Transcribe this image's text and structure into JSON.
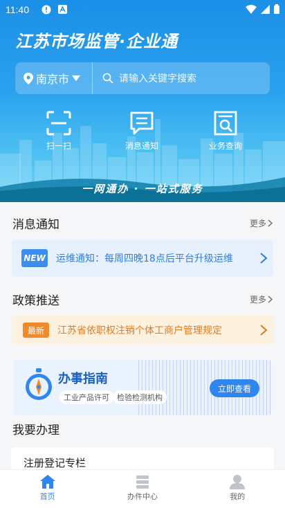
{
  "status_bar": {
    "time": "11:40"
  },
  "header": {
    "title": "江苏市场监管·企业通",
    "city": "南京市",
    "search_placeholder": "请输入关键字搜索"
  },
  "quick_actions": [
    {
      "label": "扫一扫",
      "icon": "scan-icon"
    },
    {
      "label": "消息通知",
      "icon": "message-icon"
    },
    {
      "label": "业务查询",
      "icon": "document-search-icon"
    }
  ],
  "slogan": "一网通办 · 一站式服务",
  "news": {
    "title": "消息通知",
    "more": "更多",
    "badge": "NEW",
    "text": "运维通知：每周四晚18点后平台升级运维"
  },
  "policy": {
    "title": "政策推送",
    "more": "更多",
    "badge": "最新",
    "text": "江苏省依职权注销个体工商户管理规定"
  },
  "guide": {
    "title": "办事指南",
    "tags": [
      "工业产品许可",
      "检验检测机构"
    ],
    "button": "立即查看"
  },
  "todo": {
    "title": "我要办理",
    "first_item": "注册登记专栏"
  },
  "tabbar": [
    {
      "label": "首页",
      "icon": "home-icon",
      "active": true
    },
    {
      "label": "办件中心",
      "icon": "stack-icon",
      "active": false
    },
    {
      "label": "我的",
      "icon": "user-icon",
      "active": false
    }
  ],
  "colors": {
    "primary": "#2f86ee",
    "orange": "#f08a2c",
    "hero_top": "#1b8fe6"
  }
}
